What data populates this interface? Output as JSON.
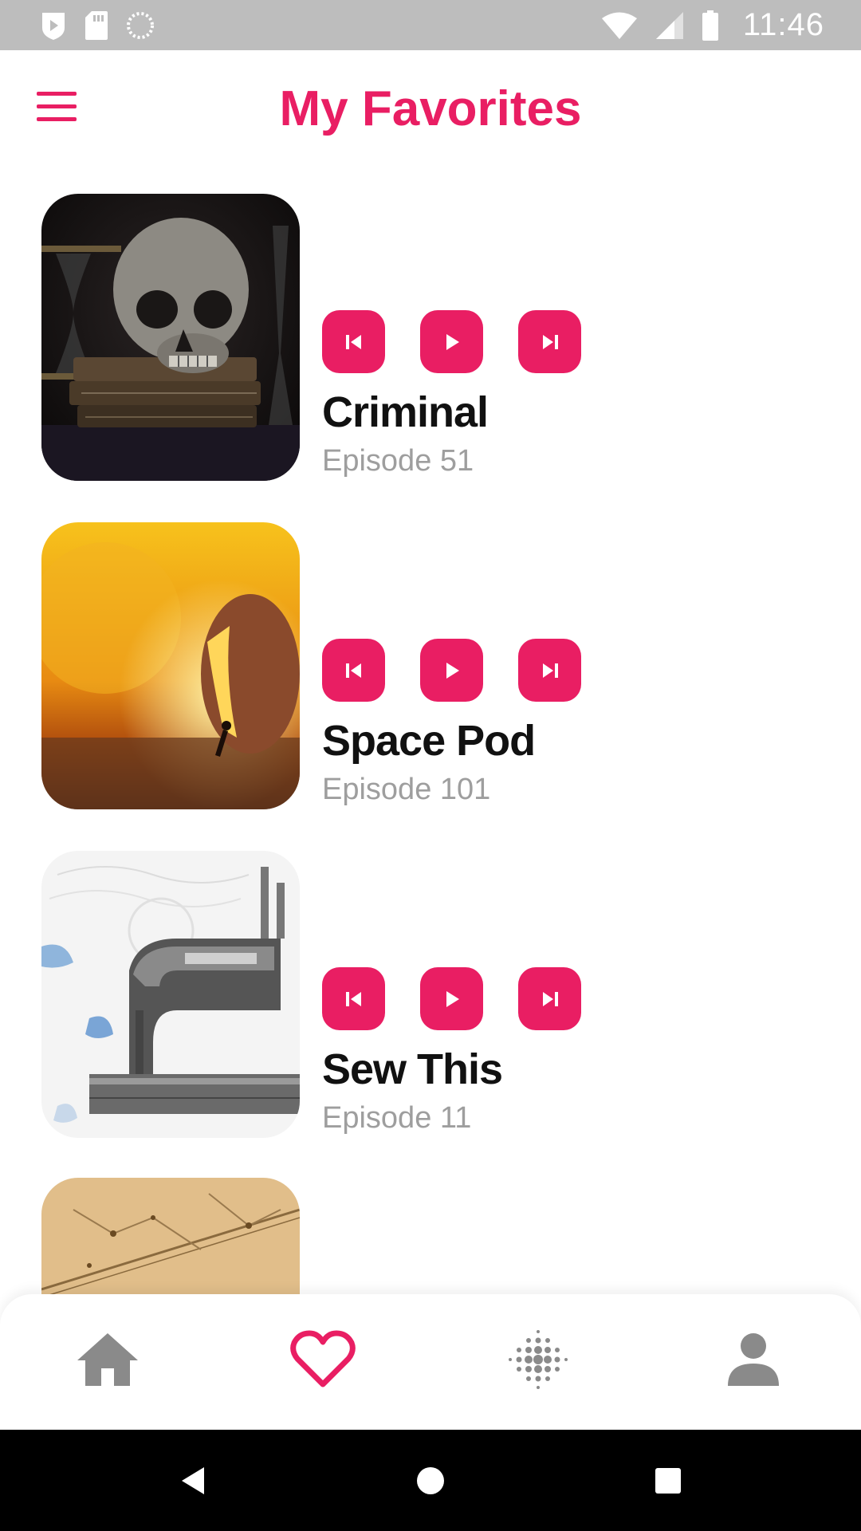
{
  "status_bar": {
    "time": "11:46"
  },
  "header": {
    "title": "My Favorites"
  },
  "favorites": [
    {
      "title": "Criminal",
      "subtitle": "Episode 51"
    },
    {
      "title": "Space Pod",
      "subtitle": "Episode 101"
    },
    {
      "title": "Sew This",
      "subtitle": "Episode 11"
    }
  ],
  "bottom_nav": {
    "items": [
      {
        "icon": "home-icon",
        "active": false
      },
      {
        "icon": "heart-icon",
        "active": true
      },
      {
        "icon": "dotted-circle-icon",
        "active": false
      },
      {
        "icon": "person-icon",
        "active": false
      }
    ]
  },
  "colors": {
    "accent": "#e91e63",
    "inactive": "#8a8a8a",
    "subtitle": "#9e9e9e"
  }
}
